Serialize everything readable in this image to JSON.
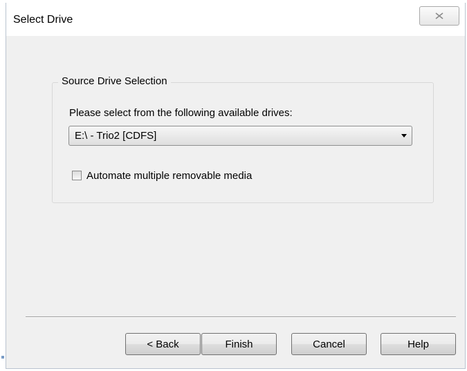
{
  "window": {
    "title": "Select Drive"
  },
  "group": {
    "legend": "Source Drive Selection",
    "instruction": "Please select from the following available drives:",
    "drive_select": {
      "selected": "E:\\ - Trio2 [CDFS]"
    },
    "automate_checkbox": {
      "label": "Automate multiple removable media",
      "checked": false
    }
  },
  "buttons": {
    "back": "< Back",
    "finish": "Finish",
    "cancel": "Cancel",
    "help": "Help"
  },
  "icons": {
    "close": "close-icon",
    "dropdown": "chevron-down-icon"
  }
}
